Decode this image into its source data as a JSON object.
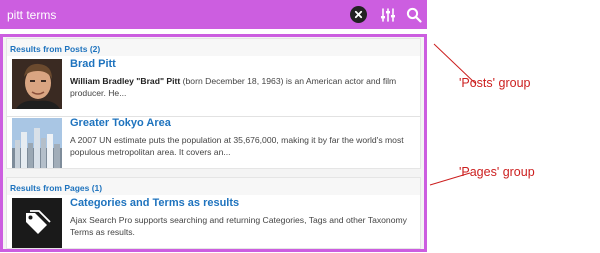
{
  "search": {
    "value": "pitt terms",
    "clear_icon": "close-icon",
    "settings_icon": "sliders-icon",
    "submit_icon": "search-icon"
  },
  "groups": [
    {
      "header": "Results from Posts (2)",
      "items": [
        {
          "title": "Brad Pitt",
          "text_bold": "William Bradley \"Brad\" Pitt",
          "text": " (born December 18, 1963) is an American actor and film producer. He..."
        },
        {
          "title": "Greater Tokyo Area",
          "text": "A 2007 UN estimate puts the population at 35,676,000, making it by far the world's most populous metropolitan area. It covers an..."
        }
      ]
    },
    {
      "header": "Results from Pages (1)",
      "items": [
        {
          "title": "Categories and Terms as results",
          "text": "Ajax Search Pro supports searching and returning Categories, Tags and other Taxonomy Terms as results.",
          "icon": "tag-icon"
        }
      ]
    }
  ],
  "annotations": {
    "posts": "'Posts' group",
    "pages": "'Pages' group"
  },
  "colors": {
    "accent": "#cc5ee0",
    "link": "#1e73be",
    "annotation": "#cc1f1f"
  }
}
